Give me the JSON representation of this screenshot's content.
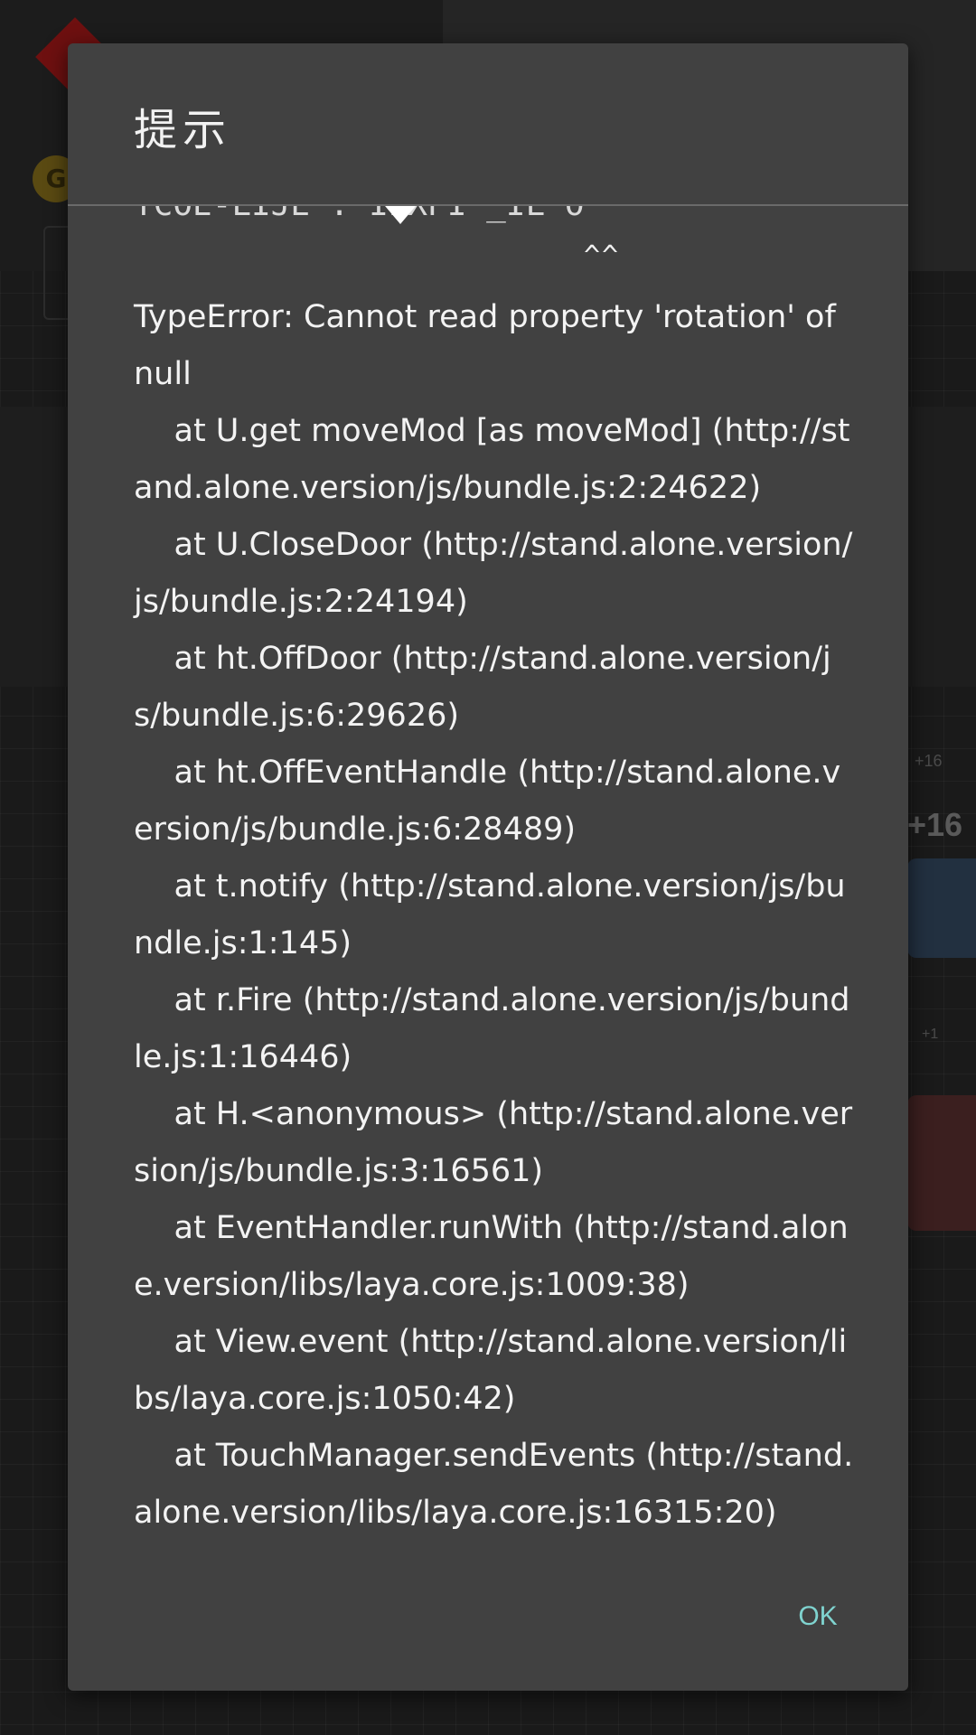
{
  "background": {
    "coin_letter": "G",
    "badge_small": "+16",
    "badge_big": "+16",
    "badge_tiny": "+1"
  },
  "dialog": {
    "title": "提示",
    "cut_off_line": "TCOE-LIJE . IIXPI _IL O",
    "caret": "^^",
    "error_message": "TypeError: Cannot read property 'rotation' of null\n    at U.get moveMod [as moveMod] (http://stand.alone.version/js/bundle.js:2:24622)\n    at U.CloseDoor (http://stand.alone.version/js/bundle.js:2:24194)\n    at ht.OffDoor (http://stand.alone.version/js/bundle.js:6:29626)\n    at ht.OffEventHandle (http://stand.alone.version/js/bundle.js:6:28489)\n    at t.notify (http://stand.alone.version/js/bundle.js:1:145)\n    at r.Fire (http://stand.alone.version/js/bundle.js:1:16446)\n    at H.<anonymous> (http://stand.alone.version/js/bundle.js:3:16561)\n    at EventHandler.runWith (http://stand.alone.version/libs/laya.core.js:1009:38)\n    at View.event (http://stand.alone.version/libs/laya.core.js:1050:42)\n    at TouchManager.sendEvents (http://stand.alone.version/libs/laya.core.js:16315:20)",
    "ok_label": "OK"
  },
  "colors": {
    "dialog_bg": "#414141",
    "text": "#f3f3f3",
    "accent": "#7fd3cf"
  }
}
